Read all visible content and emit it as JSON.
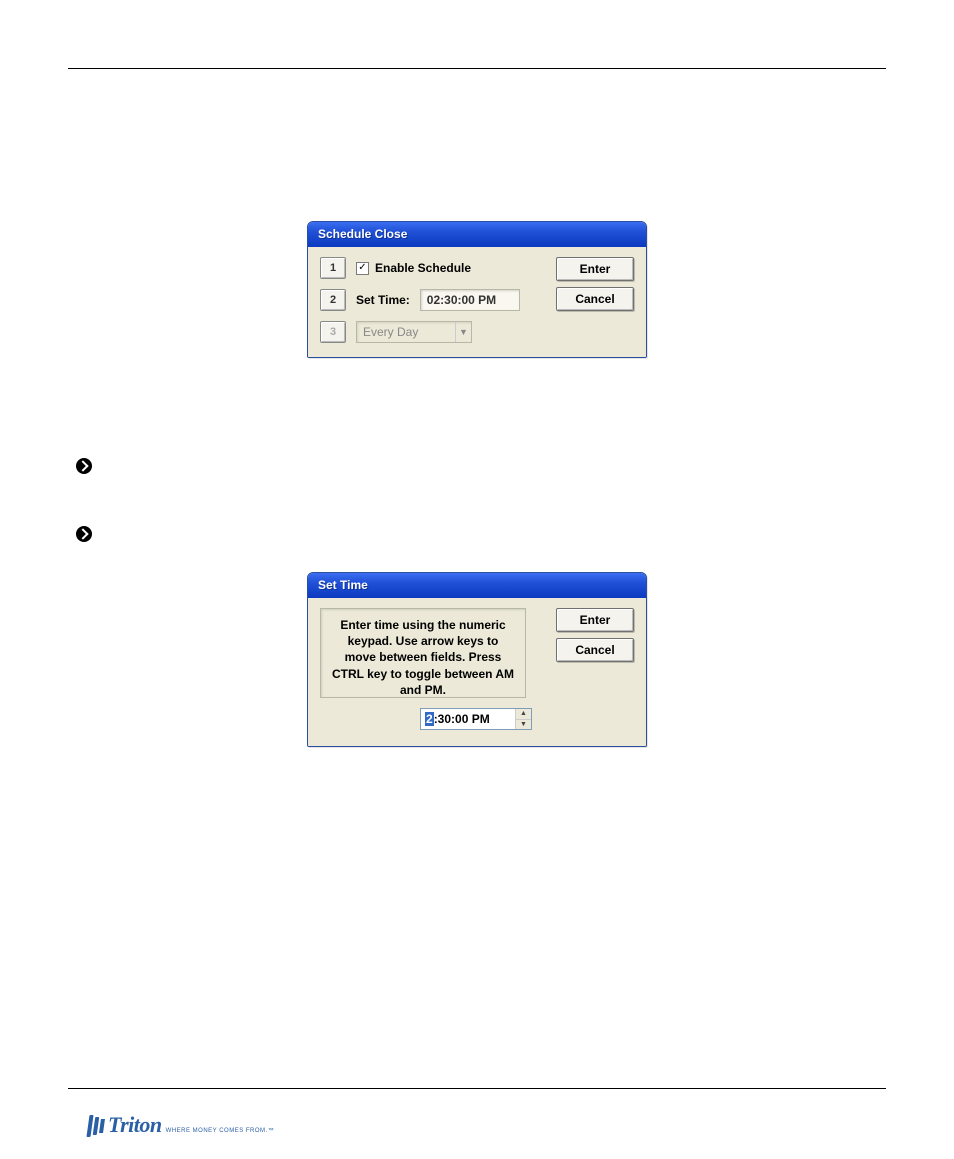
{
  "dialog1": {
    "title": "Schedule Close",
    "btn1": "1",
    "chk_checked": "✓",
    "chk_label": "Enable Schedule",
    "btn2": "2",
    "set_time_label": "Set Time:",
    "set_time_value": "02:30:00 PM",
    "btn3": "3",
    "dropdown_value": "Every Day",
    "enter": "Enter",
    "cancel": "Cancel"
  },
  "dialog2": {
    "title": "Set Time",
    "instructions": "Enter time using the numeric keypad.  Use arrow keys to move between fields.  Press CTRL key to toggle between AM and PM.",
    "spinner_hl": "2",
    "spinner_rest": ":30:00 PM",
    "enter": "Enter",
    "cancel": "Cancel"
  },
  "logo": {
    "brand": "Triton",
    "tagline": "WHERE MONEY COMES FROM.™"
  }
}
